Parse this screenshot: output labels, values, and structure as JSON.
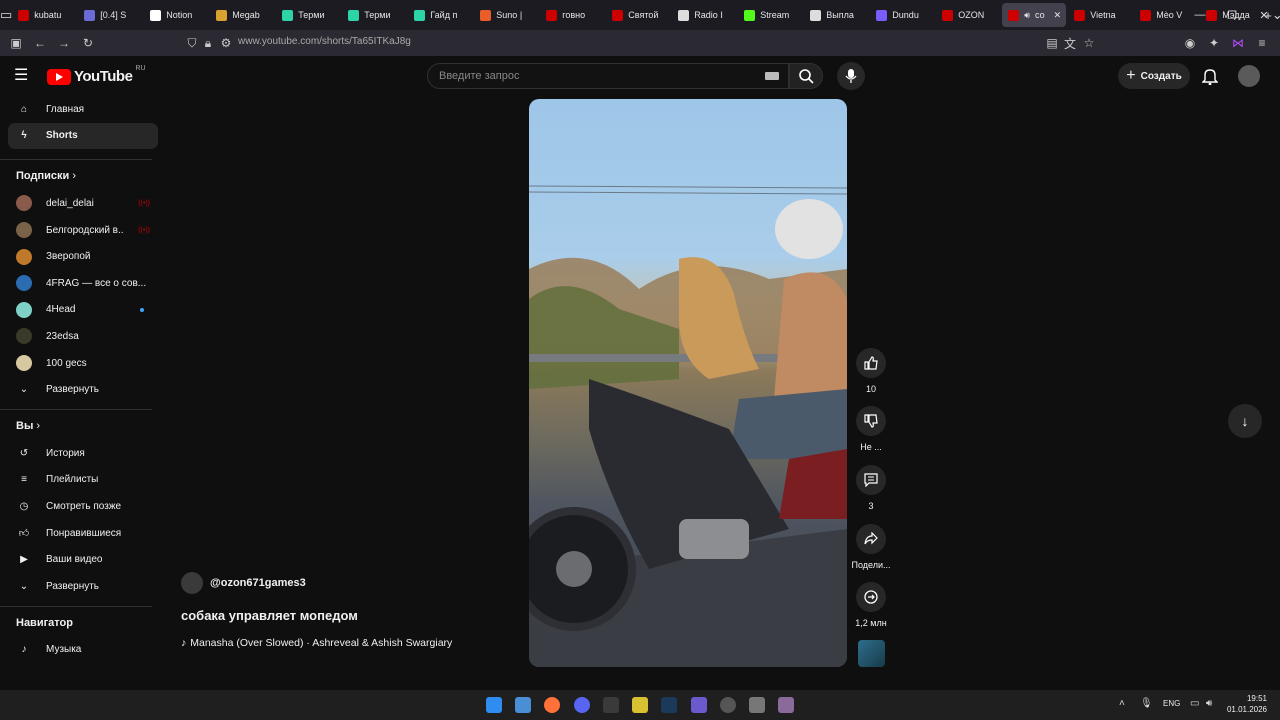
{
  "browser": {
    "tabs": [
      {
        "label": "kubatu",
        "icon": "youtube-icon",
        "color": "#cc0000"
      },
      {
        "label": "[0.4] S",
        "icon": "shield-icon",
        "color": "#6b6bd6"
      },
      {
        "label": "Notion",
        "icon": "notion-icon",
        "color": "#ffffff"
      },
      {
        "label": "Megab",
        "icon": "megabonus-icon",
        "color": "#d9a22e"
      },
      {
        "label": "Терми",
        "icon": "terminal-icon",
        "color": "#2dd4a7"
      },
      {
        "label": "Терми",
        "icon": "terminal-icon",
        "color": "#2dd4a7"
      },
      {
        "label": "Гайд п",
        "icon": "terminal-icon",
        "color": "#2dd4a7"
      },
      {
        "label": "Suno |",
        "icon": "suno-icon",
        "color": "#e85d2a"
      },
      {
        "label": "говно",
        "icon": "youtube-icon",
        "color": "#cc0000"
      },
      {
        "label": "Святой",
        "icon": "youtube-icon",
        "color": "#cc0000"
      },
      {
        "label": "Radio I",
        "icon": "radio-icon",
        "color": "#dddddd"
      },
      {
        "label": "Stream",
        "icon": "kick-icon",
        "color": "#53fc18"
      },
      {
        "label": "Выпла",
        "icon": "x-icon",
        "color": "#dddddd"
      },
      {
        "label": "Dundu",
        "icon": "dundu-icon",
        "color": "#7a5cff"
      },
      {
        "label": "OZON",
        "icon": "youtube-icon",
        "color": "#cc0000"
      },
      {
        "label": "со",
        "icon": "youtube-icon",
        "color": "#cc0000"
      },
      {
        "label": "Vietna",
        "icon": "youtube-icon",
        "color": "#cc0000"
      },
      {
        "label": "Mèo V",
        "icon": "youtube-icon",
        "color": "#cc0000"
      },
      {
        "label": "Мэдда",
        "icon": "youtube-icon",
        "color": "#cc0000"
      }
    ],
    "url": "www.youtube.com/shorts/Ta65ITKaJ8g"
  },
  "youtube": {
    "brand": "YouTube",
    "region": "RU",
    "search_placeholder": "Введите запрос",
    "create_label": "Создать"
  },
  "sidebar": {
    "main": [
      {
        "label": "Главная",
        "icon": "home-icon"
      },
      {
        "label": "Shorts",
        "icon": "shorts-icon",
        "active": true
      }
    ],
    "subs_header": "Подписки",
    "subscriptions": [
      {
        "label": "delai_delai",
        "color": "#8a5a4a",
        "live": true
      },
      {
        "label": "Белгородский в...",
        "color": "#7a6248",
        "live": true
      },
      {
        "label": "Зверопой",
        "color": "#c0782a"
      },
      {
        "label": "4FRAG — все о сов...",
        "color": "#2b6cb0"
      },
      {
        "label": "4Head",
        "color": "#7fd1c7",
        "new": true
      },
      {
        "label": "23edsa",
        "color": "#3a3a2a"
      },
      {
        "label": "100 gecs",
        "color": "#d8c8a0"
      }
    ],
    "expand1": "Развернуть",
    "you_header": "Вы",
    "you_items": [
      {
        "label": "История",
        "icon": "history-icon"
      },
      {
        "label": "Плейлисты",
        "icon": "playlist-icon"
      },
      {
        "label": "Смотреть позже",
        "icon": "clock-icon"
      },
      {
        "label": "Понравившиеся",
        "icon": "thumbs-up-icon"
      },
      {
        "label": "Ваши видео",
        "icon": "video-icon"
      }
    ],
    "expand2": "Развернуть",
    "nav_header": "Навигатор",
    "nav_items": [
      {
        "label": "Музыка",
        "icon": "music-icon"
      }
    ]
  },
  "short": {
    "channel": "@ozon671games3",
    "title": "собака управляет мопедом",
    "music": "Manasha (Over Slowed) · Ashreveal & Ashish Swargiary",
    "likes": "10",
    "dislike_label": "Не ...",
    "comments": "3",
    "share_label": "Подели...",
    "remix_label": "1,2 млн"
  },
  "taskbar": {
    "lang": "ENG",
    "time": "19:51",
    "date": "01.01.2026"
  }
}
